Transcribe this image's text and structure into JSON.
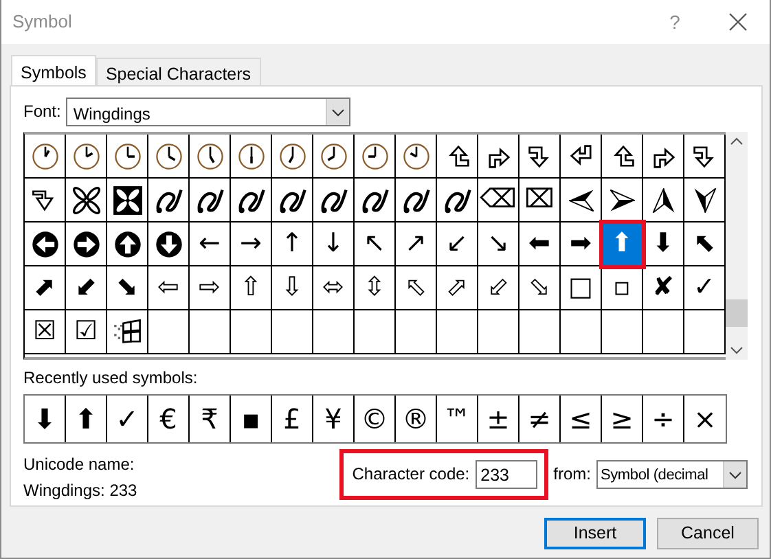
{
  "window": {
    "title": "Symbol",
    "help": "?"
  },
  "tabs": [
    {
      "label": "Symbols",
      "selected": true
    },
    {
      "label": "Special Characters",
      "selected": false
    }
  ],
  "font": {
    "label": "Font:",
    "value": "Wingdings"
  },
  "symbol_grid": {
    "highlight_selected": true,
    "rows": [
      [
        {
          "kind": "clock",
          "selected": false
        },
        {
          "kind": "clock",
          "selected": false
        },
        {
          "kind": "clock",
          "selected": false
        },
        {
          "kind": "clock",
          "selected": false
        },
        {
          "kind": "clock",
          "selected": false
        },
        {
          "kind": "clock",
          "selected": false
        },
        {
          "kind": "clock",
          "selected": false
        },
        {
          "kind": "clock",
          "selected": false
        },
        {
          "kind": "clock",
          "selected": false
        },
        {
          "kind": "clock",
          "selected": false
        },
        {
          "kind": "bent-arrow",
          "selected": false
        },
        {
          "kind": "bent-arrow",
          "selected": false
        },
        {
          "kind": "bent-arrow",
          "selected": false
        },
        {
          "kind": "bent-arrow",
          "selected": false
        },
        {
          "kind": "bent-arrow",
          "selected": false
        },
        {
          "kind": "bent-arrow",
          "selected": false
        },
        {
          "kind": "bent-arrow",
          "selected": false
        }
      ],
      [
        {
          "kind": "hollow-arrow",
          "selected": false
        },
        {
          "kind": "petal-cross",
          "selected": false
        },
        {
          "kind": "boxed-petal-cross",
          "selected": false
        },
        {
          "kind": "swirl",
          "selected": false
        },
        {
          "kind": "swirl",
          "selected": false
        },
        {
          "kind": "swirl",
          "selected": false
        },
        {
          "kind": "swirl",
          "selected": false
        },
        {
          "kind": "swirl",
          "selected": false
        },
        {
          "kind": "swirl",
          "selected": false
        },
        {
          "kind": "swirl",
          "selected": false
        },
        {
          "kind": "swirl",
          "selected": false
        },
        {
          "kind": "char",
          "char": "⌫",
          "selected": false
        },
        {
          "kind": "char",
          "char": "⌧",
          "selected": false
        },
        {
          "kind": "dart-left",
          "selected": false
        },
        {
          "kind": "dart-right",
          "selected": false
        },
        {
          "kind": "dart-up",
          "selected": false
        },
        {
          "kind": "dart-down",
          "selected": false
        }
      ],
      [
        {
          "kind": "circle-arrow-left",
          "selected": false
        },
        {
          "kind": "circle-arrow-right",
          "selected": false
        },
        {
          "kind": "circle-arrow-up",
          "selected": false
        },
        {
          "kind": "circle-arrow-down",
          "selected": false
        },
        {
          "kind": "char",
          "char": "←",
          "selected": false
        },
        {
          "kind": "char",
          "char": "→",
          "selected": false
        },
        {
          "kind": "char",
          "char": "↑",
          "selected": false
        },
        {
          "kind": "char",
          "char": "↓",
          "selected": false
        },
        {
          "kind": "char",
          "char": "↖",
          "selected": false
        },
        {
          "kind": "char",
          "char": "↗",
          "selected": false
        },
        {
          "kind": "char",
          "char": "↙",
          "selected": false
        },
        {
          "kind": "char",
          "char": "↘",
          "selected": false
        },
        {
          "kind": "char",
          "char": "⬅",
          "selected": false
        },
        {
          "kind": "char",
          "char": "➡",
          "selected": false
        },
        {
          "kind": "char",
          "char": "⬆",
          "selected": true
        },
        {
          "kind": "char",
          "char": "⬇",
          "selected": false
        },
        {
          "kind": "char",
          "char": "⬉",
          "selected": false
        }
      ],
      [
        {
          "kind": "char",
          "char": "⬈",
          "selected": false
        },
        {
          "kind": "char",
          "char": "⬋",
          "selected": false
        },
        {
          "kind": "char",
          "char": "⬊",
          "selected": false
        },
        {
          "kind": "char",
          "char": "⇦",
          "selected": false
        },
        {
          "kind": "char",
          "char": "⇨",
          "selected": false
        },
        {
          "kind": "char",
          "char": "⇧",
          "selected": false
        },
        {
          "kind": "char",
          "char": "⇩",
          "selected": false
        },
        {
          "kind": "char",
          "char": "⬄",
          "selected": false
        },
        {
          "kind": "char",
          "char": "⇳",
          "selected": false
        },
        {
          "kind": "char",
          "char": "⬁",
          "selected": false
        },
        {
          "kind": "char",
          "char": "⬀",
          "selected": false
        },
        {
          "kind": "char",
          "char": "⬃",
          "selected": false
        },
        {
          "kind": "char",
          "char": "⬂",
          "selected": false
        },
        {
          "kind": "char",
          "char": "□",
          "selected": false
        },
        {
          "kind": "char",
          "char": "▫",
          "selected": false
        },
        {
          "kind": "char",
          "char": "✘",
          "selected": false
        },
        {
          "kind": "char",
          "char": "✓",
          "selected": false
        }
      ],
      [
        {
          "kind": "char",
          "char": "☒",
          "selected": false
        },
        {
          "kind": "char",
          "char": "☑",
          "selected": false
        },
        {
          "kind": "four-pane",
          "selected": false
        },
        {
          "kind": "empty",
          "selected": false
        },
        {
          "kind": "empty",
          "selected": false
        },
        {
          "kind": "empty",
          "selected": false
        },
        {
          "kind": "empty",
          "selected": false
        },
        {
          "kind": "empty",
          "selected": false
        },
        {
          "kind": "empty",
          "selected": false
        },
        {
          "kind": "empty",
          "selected": false
        },
        {
          "kind": "empty",
          "selected": false
        },
        {
          "kind": "empty",
          "selected": false
        },
        {
          "kind": "empty",
          "selected": false
        },
        {
          "kind": "empty",
          "selected": false
        },
        {
          "kind": "empty",
          "selected": false
        },
        {
          "kind": "empty",
          "selected": false
        },
        {
          "kind": "empty",
          "selected": false
        }
      ]
    ]
  },
  "recent": {
    "label": "Recently used symbols:",
    "symbols": [
      "⬇",
      "⬆",
      "✓",
      "€",
      "₹",
      "▪",
      "£",
      "¥",
      "©",
      "®",
      "™",
      "±",
      "≠",
      "≤",
      "≥",
      "÷",
      "×"
    ]
  },
  "unicode_name": {
    "label": "Unicode name:",
    "value": "Wingdings: 233"
  },
  "character_code": {
    "label": "Character code:",
    "value": "233",
    "highlighted": true
  },
  "from": {
    "label": "from:",
    "value": "Symbol (decimal"
  },
  "buttons": [
    {
      "label": "Insert",
      "default": true
    },
    {
      "label": "Cancel",
      "default": false
    }
  ]
}
